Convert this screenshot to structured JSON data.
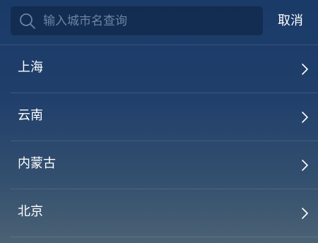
{
  "search": {
    "placeholder": "输入城市名查询",
    "value": "",
    "icon": "search-icon"
  },
  "cancel_label": "取消",
  "list": {
    "items": [
      {
        "label": "上海",
        "icon": "chevron-right-icon"
      },
      {
        "label": "云南",
        "icon": "chevron-right-icon"
      },
      {
        "label": "内蒙古",
        "icon": "chevron-right-icon"
      },
      {
        "label": "北京",
        "icon": "chevron-right-icon"
      }
    ]
  },
  "colors": {
    "background_top": "#1a3a68",
    "background_bottom": "#4b6274",
    "search_box_bg": "#102a4f",
    "placeholder_text": "#6d84a3",
    "text": "#ffffff"
  }
}
